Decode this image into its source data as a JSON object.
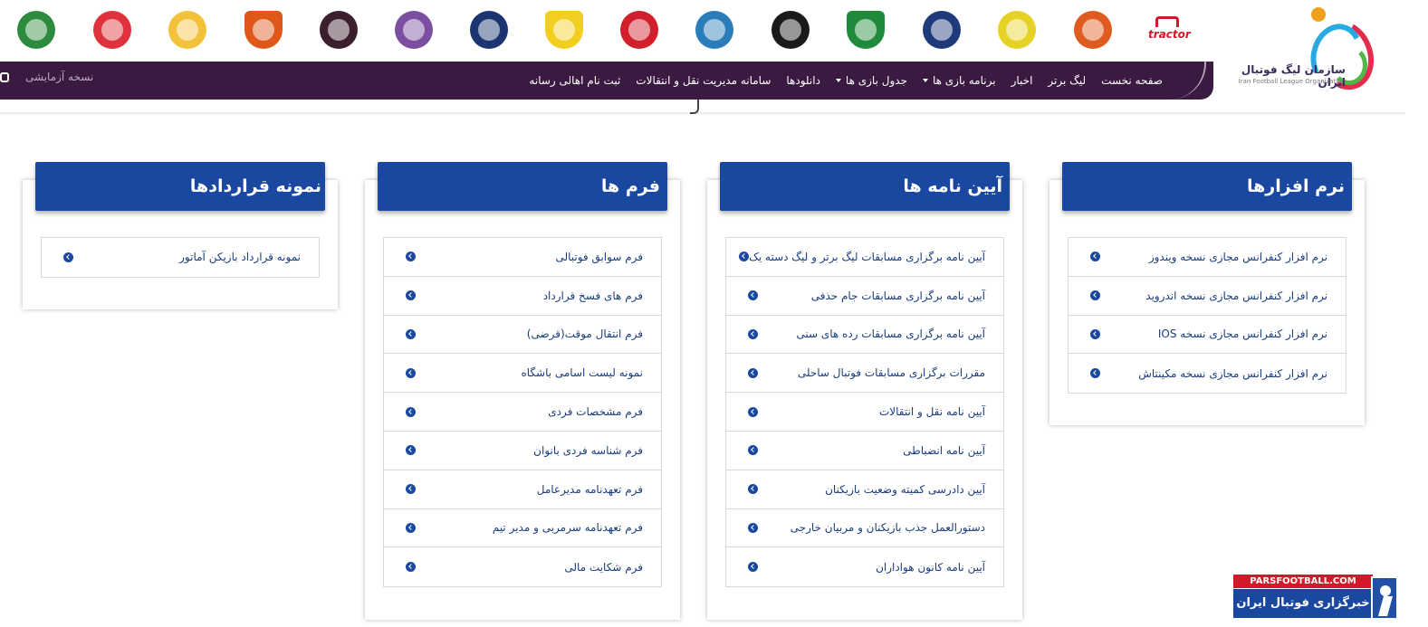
{
  "colors": {
    "nav_bg": "#3a1a40",
    "header_blue": "#1a48a0",
    "link_text": "#1a3d7c"
  },
  "logos": {
    "team_logos": [
      {
        "name": "zob-ahan-logo",
        "color": "#2e8b3e"
      },
      {
        "name": "foolad-mobarakeh-logo",
        "color": "#e0323c"
      },
      {
        "name": "naft-masjed-logo",
        "color": "#f2c23a"
      },
      {
        "name": "mes-rafsanjan-logo",
        "color": "#e0571a"
      },
      {
        "name": "nassaji-logo",
        "color": "#3b1f2e"
      },
      {
        "name": "havadar-logo",
        "color": "#7c4ea0"
      },
      {
        "name": "paykan-logo",
        "color": "#1a3570"
      },
      {
        "name": "sanat-naft-logo",
        "color": "#f2cf1f"
      },
      {
        "name": "persepolis-logo",
        "color": "#d11f2b"
      },
      {
        "name": "esteghlal-logo",
        "color": "#2a7db8"
      },
      {
        "name": "sepahan-logo",
        "color": "#1a1a1a"
      },
      {
        "name": "zob-ahan-green-logo",
        "color": "#1f8a3a"
      },
      {
        "name": "malavan-logo",
        "color": "#1f3a7a"
      },
      {
        "name": "aluminium-arak-logo",
        "color": "#e6d225"
      },
      {
        "name": "foolad-khuzestan-logo",
        "color": "#e05b1f"
      }
    ],
    "tractor_text": "tractor",
    "org_name": "سازمان لیگ فوتبال ایران",
    "org_name_en": "Iran Football League Organization"
  },
  "nav": {
    "items": [
      {
        "label": "صفحه نخست",
        "has_caret": false
      },
      {
        "label": "لیگ برتر",
        "has_caret": false
      },
      {
        "label": "اخبار",
        "has_caret": false
      },
      {
        "label": "برنامه بازی ها",
        "has_caret": true
      },
      {
        "label": "جدول بازی ها",
        "has_caret": true
      },
      {
        "label": "دانلودها",
        "has_caret": false
      },
      {
        "label": "سامانه مدیریت نقل و انتقالات",
        "has_caret": false
      },
      {
        "label": "ثبت نام اهالی رسانه",
        "has_caret": false
      }
    ],
    "beta_label": "نسخه آزمایشی"
  },
  "cards": [
    {
      "title": "نرم افزارها",
      "items": [
        "نرم افزار کنفرانس مجازی نسخه ویندوز",
        "نرم افزار کنفرانس مجازی نسخه اندروید",
        "نرم افزار کنفرانس مجازی نسخه IOS",
        "نرم افزار کنفرانس مجازی نسخه مکینتاش"
      ]
    },
    {
      "title": "آیین نامه ها",
      "items": [
        "آیین نامه برگزاری مسابقات لیگ برتر و لیگ دسته یک",
        "آیین نامه برگزاری مسابقات جام حذفی",
        "آیین نامه برگزاری مسابقات رده های سنی",
        "مقررات برگزاری مسابقات فوتبال ساحلی",
        "آیین نامه نقل و انتقالات",
        "آیین نامه انضباطی",
        "آیین دادرسی کمیته وضعیت بازیکنان",
        "دستورالعمل جذب بازیکنان و مربیان خارجی",
        "آیین نامه کانون هواداران"
      ]
    },
    {
      "title": "فرم ها",
      "items": [
        "فرم سوابق فوتبالی",
        "فرم های فسخ قرارداد",
        "فرم انتقال موقت(قرضی)",
        "نمونه لیست اسامی باشگاه",
        "فرم مشخصات فردی",
        "فرم شناسه فردی بانوان",
        "فرم تعهدنامه مدیرعامل",
        "فرم تعهدنامه سرمربی و مدیر تیم",
        "فرم شکایت مالی"
      ]
    },
    {
      "title": "نمونه قراردادها",
      "items": [
        "نمونه قرارداد بازیکن آماتور"
      ]
    }
  ],
  "watermark": {
    "top": "PARSFOOTBALL.COM",
    "bottom": "خبرگزاری فوتبال ایران"
  }
}
